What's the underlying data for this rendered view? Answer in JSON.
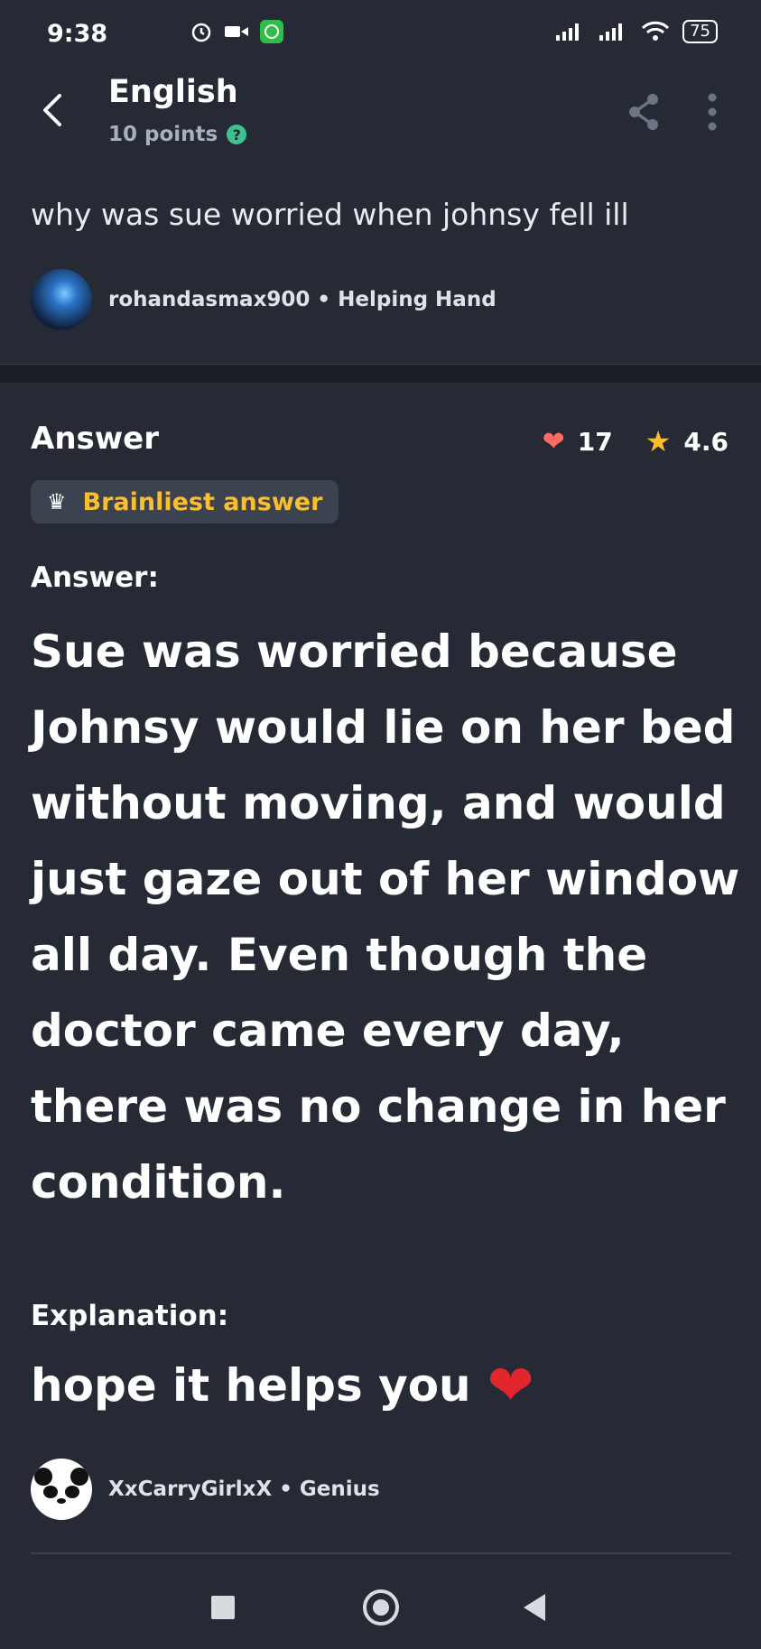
{
  "status_bar": {
    "time": "9:38",
    "battery": "75"
  },
  "header": {
    "subject": "English",
    "points": "10 points",
    "help_symbol": "?"
  },
  "question": {
    "text": "why was sue worried when johnsy fell ill",
    "asker": "rohandasmax900 • Helping Hand"
  },
  "answer": {
    "section_label": "Answer",
    "likes": "17",
    "rating": "4.6",
    "badge": "Brainliest answer",
    "heading": "Answer:",
    "body": "Sue was worried because Johnsy would lie on her bed without moving, and would just gaze out of her window all day. Even though the doctor came every day, there was no change in her condition.",
    "explanation_heading": "Explanation:",
    "explanation_body": "hope it helps you",
    "answerer": "XxCarryGirlxX • Genius"
  },
  "colors": {
    "background": "#252a35",
    "accent_yellow": "#fbbe2e",
    "heart_red": "#ff6b63",
    "help_green": "#3ec18f"
  }
}
